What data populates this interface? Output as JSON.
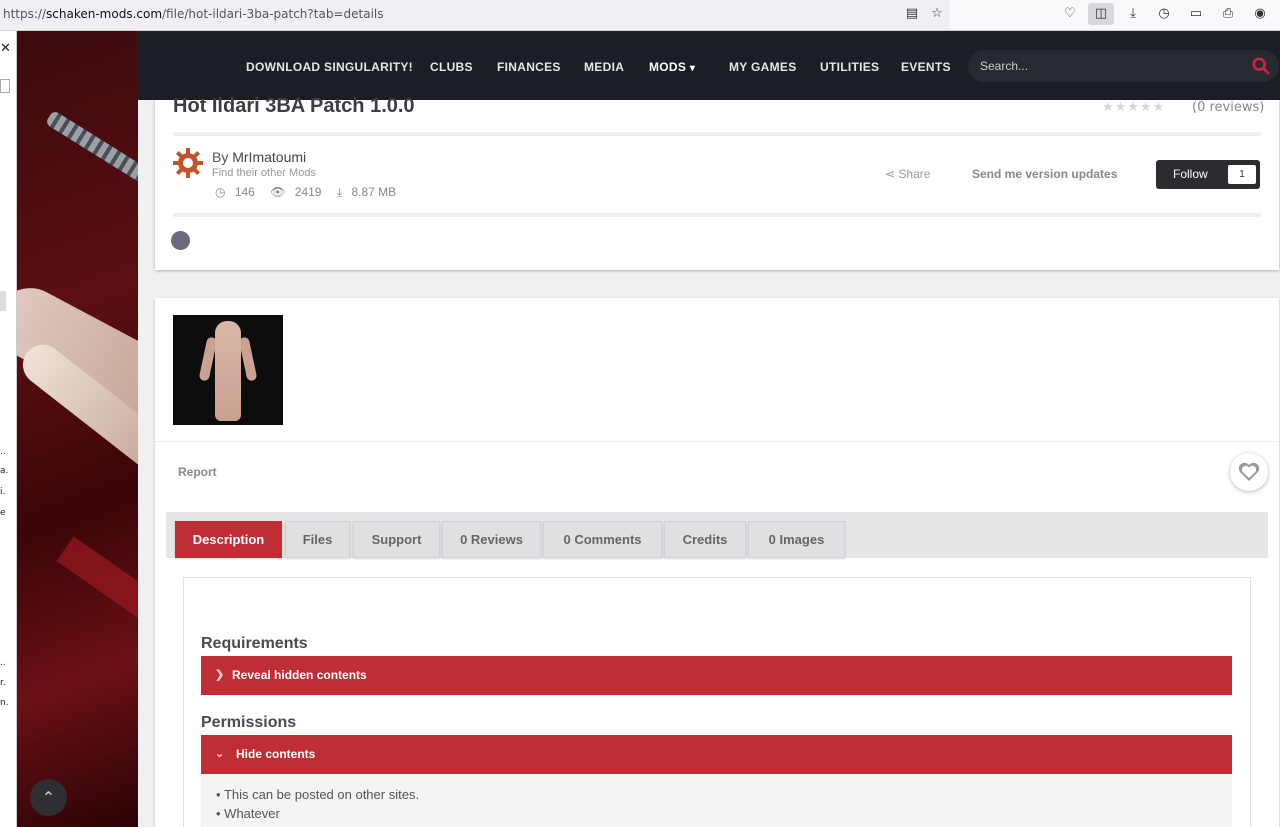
{
  "browser": {
    "url_prefix": "https://",
    "url_host": "schaken-mods.com",
    "url_path": "/file/hot-ildari-3ba-patch?tab=details"
  },
  "left_strip": {
    "fragments": [
      "..",
      "a.",
      "i.",
      "e",
      "..",
      "r.",
      "n."
    ]
  },
  "nav": {
    "items": [
      "DOWNLOAD SINGULARITY!",
      "CLUBS",
      "FINANCES",
      "MEDIA",
      "MODS",
      "MY GAMES",
      "UTILITIES",
      "EVENTS"
    ],
    "active": "MODS",
    "search_placeholder": "Search...",
    "accent": "#d1204e"
  },
  "file": {
    "title": "Hot Ildari 3BA Patch 1.0.0",
    "rating": 0,
    "reviews_text": "(0 reviews)",
    "by_prefix": "By",
    "author": "MrImatoumi",
    "other_mods": "Find their other Mods",
    "comments": "146",
    "views": "2419",
    "size": "8.87 MB",
    "share": "Share",
    "version_updates": "Send me version updates",
    "follow": "Follow",
    "follow_count": "1"
  },
  "main": {
    "report": "Report",
    "tabs": [
      "Description",
      "Files",
      "Support",
      "0 Reviews",
      "0 Comments",
      "Credits",
      "0 Images"
    ],
    "active_tab": "Description",
    "requirements_title": "Requirements",
    "reveal_label": "Reveal hidden contents",
    "permissions_title": "Permissions",
    "hide_label": "Hide contents",
    "permissions": [
      "This can be posted on other sites.",
      "Whatever"
    ],
    "brand_red": "#bf2e34"
  }
}
